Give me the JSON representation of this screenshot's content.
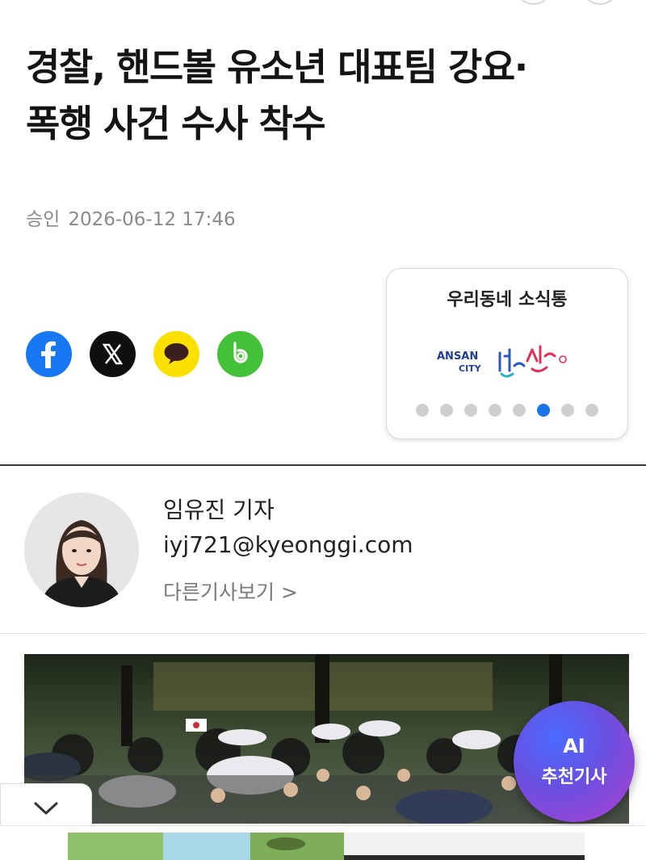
{
  "article": {
    "headline_line1": "경찰, 핸드볼 유소년 대표팀 강요·",
    "headline_line2": "폭행 사건 수사 착수",
    "approved_label": "승인",
    "approved_datetime": "2026-06-12 17:46"
  },
  "share": {
    "buttons": [
      "facebook-icon",
      "x-icon",
      "kakaotalk-icon",
      "band-icon"
    ],
    "colors": {
      "facebook": "#1877f2",
      "x": "#0f0f0f",
      "kakao": "#fae100",
      "band": "#43c138"
    }
  },
  "local_news_widget": {
    "title": "우리동네 소식통",
    "logo_text_en_1": "ANSAN",
    "logo_text_en_2": "CITY",
    "logo_text_kr": "안산",
    "dot_count": 8,
    "active_dot_index": 5
  },
  "reporter": {
    "name": "임유진 기자",
    "email": "iyj721@kyeonggi.com",
    "more_link": "다른기사보기 >"
  },
  "ai_button": {
    "title": "AI",
    "subtitle": "추천기사"
  },
  "collapse_button": {
    "icon": "chevron-down-icon"
  },
  "colors": {
    "accent_blue": "#1a73e8",
    "ai_gradient_start": "#4b6bff",
    "ai_gradient_end": "#b13fd0"
  }
}
